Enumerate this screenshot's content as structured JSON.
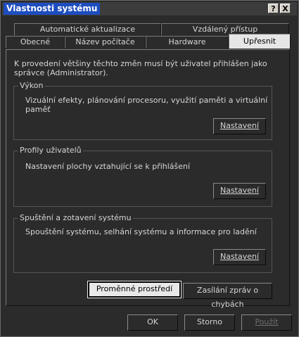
{
  "window": {
    "title": "Vlastnosti systému",
    "help_button": "?",
    "close_button": "X"
  },
  "tabs": {
    "row1": [
      "Automatické aktualizace",
      "Vzdálený přístup"
    ],
    "row2": [
      "Obecné",
      "Název počítače",
      "Hardware",
      "Upřesnit"
    ],
    "active": "Upřesnit"
  },
  "intro": "K provedení většiny těchto změn musí být uživatel přihlášen jako správce (Administrator).",
  "groups": {
    "performance": {
      "title": "Výkon",
      "description": "Vizuální efekty, plánování procesoru, využití paměti a virtuální paměť",
      "button": "Nastavení"
    },
    "profiles": {
      "title": "Profily uživatelů",
      "description": "Nastavení plochy vztahující se k přihlášení",
      "button": "Nastavení"
    },
    "startup": {
      "title": "Spuštění a zotavení systému",
      "description": "Spouštění systému, selhání systému a informace pro ladění",
      "button": "Nastavení"
    }
  },
  "buttons": {
    "env_vars": "Proměnné prostředí",
    "error_reporting": "Zasílání zpráv o chybách",
    "ok": "OK",
    "cancel": "Storno",
    "apply": "Použít"
  }
}
